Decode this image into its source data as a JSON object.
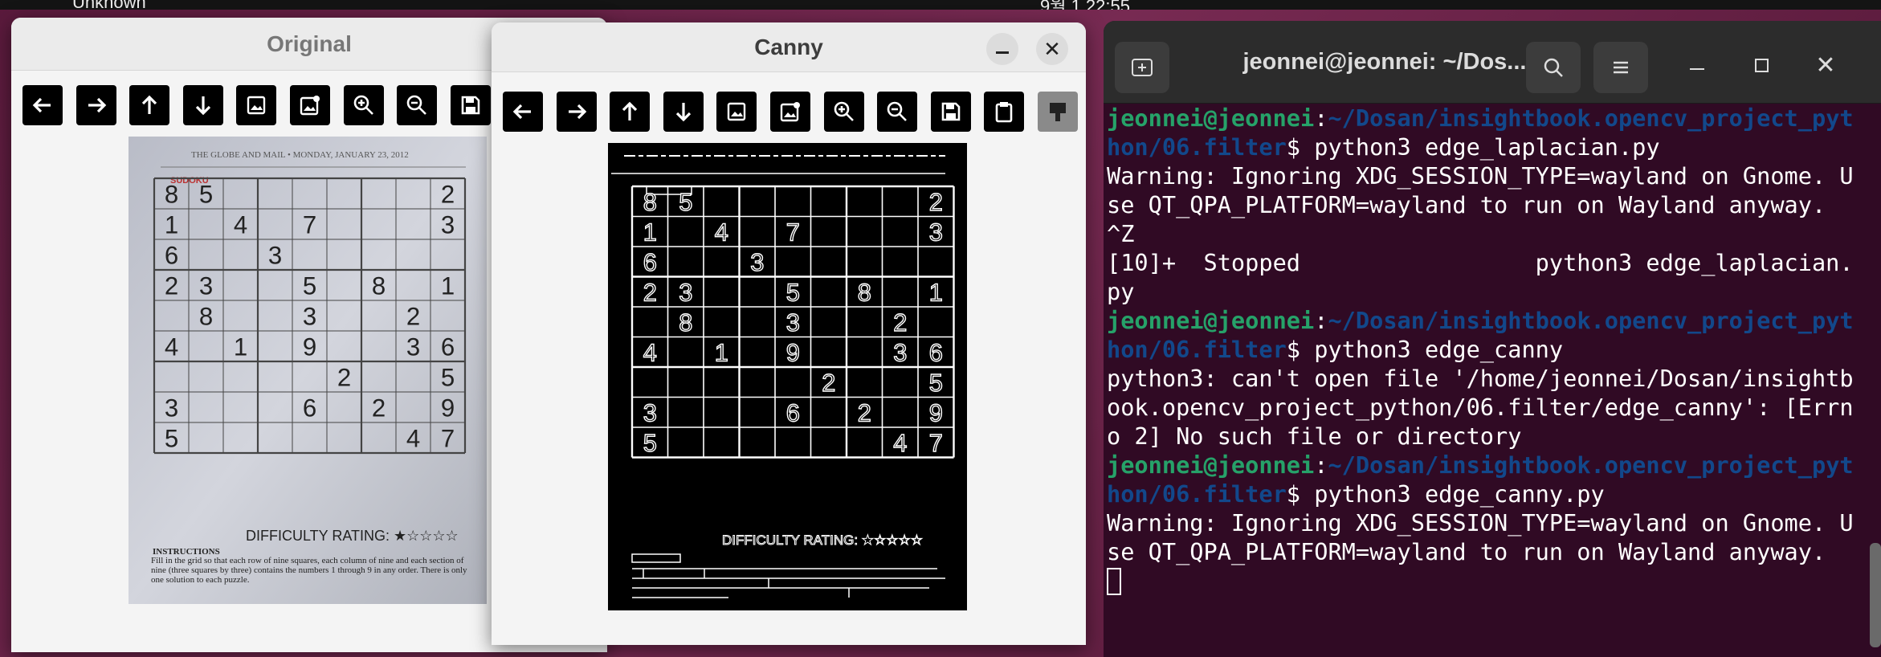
{
  "topbar": {
    "left_text": "Unknown",
    "clock": "9월 1 22:55"
  },
  "original_window": {
    "title": "Original"
  },
  "canny_window": {
    "title": "Canny"
  },
  "toolbar_icons": [
    "arrow-left-icon",
    "arrow-right-icon",
    "arrow-up-icon",
    "arrow-down-icon",
    "image-icon",
    "image-edit-icon",
    "zoom-in-icon",
    "zoom-out-icon",
    "save-icon",
    "clipboard-icon",
    "paint-icon"
  ],
  "newspaper": {
    "header": "THE GLOBE AND MAIL  •  MONDAY, JANUARY 23, 2012",
    "section": "SUDOKU",
    "difficulty": "DIFFICULTY RATING: ★☆☆☆☆",
    "instructions_title": "INSTRUCTIONS",
    "instructions": "Fill in the grid so that each row of nine squares, each column of nine and each section of nine (three squares by three) contains the numbers 1 through 9 in any order. There is only one solution to each puzzle.",
    "grid": [
      [
        "8",
        "5",
        "",
        "",
        "",
        "",
        "",
        "",
        "2"
      ],
      [
        "1",
        "",
        "4",
        "",
        "7",
        "",
        "",
        "",
        "3"
      ],
      [
        "6",
        "",
        "",
        "3",
        "",
        "",
        "",
        "",
        ""
      ],
      [
        "2",
        "3",
        "",
        "",
        "5",
        "",
        "8",
        "",
        "1"
      ],
      [
        "",
        "8",
        "",
        "",
        "3",
        "",
        "",
        "2",
        ""
      ],
      [
        "4",
        "",
        "1",
        "",
        "9",
        "",
        "",
        "3",
        "6"
      ],
      [
        "",
        "",
        "",
        "",
        "",
        "2",
        "",
        "",
        "5"
      ],
      [
        "3",
        "",
        "",
        "",
        "6",
        "",
        "2",
        "",
        "9"
      ],
      [
        "5",
        "",
        "",
        "",
        "",
        "",
        "",
        "4",
        "7"
      ]
    ]
  },
  "terminal": {
    "title": "jeonnei@jeonnei: ~/Dos...",
    "lines": [
      {
        "user": "jeonnei@jeonnei",
        "path": "~/Dosan/insightbook.opencv_project_python/06.filter",
        "cmd": "$ python3 edge_laplacian.py"
      },
      {
        "text": "Warning: Ignoring XDG_SESSION_TYPE=wayland on Gnome. Use QT_QPA_PLATFORM=wayland to run on Wayland anyway."
      },
      {
        "text": "^Z"
      },
      {
        "text": "[10]+  Stopped                 python3 edge_laplacian.py"
      },
      {
        "user": "jeonnei@jeonnei",
        "path": "~/Dosan/insightbook.opencv_project_python/06.filter",
        "cmd": "$ python3 edge_canny"
      },
      {
        "text": "python3: can't open file '/home/jeonnei/Dosan/insightbook.opencv_project_python/06.filter/edge_canny': [Errno 2] No such file or directory"
      },
      {
        "user": "jeonnei@jeonnei",
        "path": "~/Dosan/insightbook.opencv_project_python/06.filter",
        "cmd": "$ python3 edge_canny.py"
      },
      {
        "text": "Warning: Ignoring XDG_SESSION_TYPE=wayland on Gnome. Use QT_QPA_PLATFORM=wayland to run on Wayland anyway."
      }
    ]
  },
  "colors": {
    "terminal_bg": "#300a24",
    "prompt_user": "#26a269",
    "prompt_path": "#12488b"
  }
}
